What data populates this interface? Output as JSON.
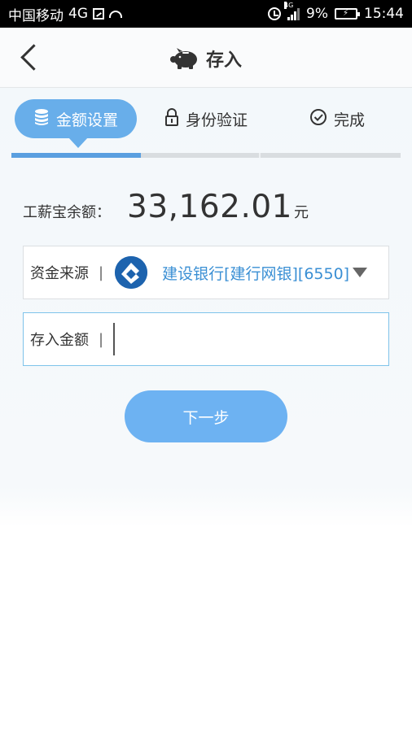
{
  "status_bar": {
    "carrier": "中国移动",
    "network": "4G",
    "signal_network": "4G",
    "battery": "9%",
    "time": "15:44"
  },
  "nav": {
    "title": "存入",
    "back_icon": "chevron-left-icon",
    "title_icon": "piggy-bank-icon"
  },
  "steps": [
    {
      "label": "金额设置",
      "icon": "coins-stack-icon",
      "active": true
    },
    {
      "label": "身份验证",
      "icon": "lock-icon",
      "active": false
    },
    {
      "label": "完成",
      "icon": "check-circle-icon",
      "active": false
    }
  ],
  "progress": {
    "current_step": 1,
    "total_steps": 3
  },
  "balance": {
    "label": "工薪宝余额：",
    "value": "33,162.01",
    "unit": "元"
  },
  "form": {
    "source": {
      "label": "资金来源",
      "separator": "|",
      "bank_icon": "ccb-bank-logo-icon",
      "value": "建设银行[建行网银][6550]"
    },
    "amount": {
      "label": "存入金额",
      "separator": "|",
      "value": "",
      "placeholder": ""
    }
  },
  "next_button": {
    "label": "下一步"
  },
  "colors": {
    "accent": "#68aeea",
    "progress": "#5a9fe0",
    "bank_text": "#3a8fd4",
    "button": "#6db2f2",
    "bank_logo": "#1d63ae"
  }
}
